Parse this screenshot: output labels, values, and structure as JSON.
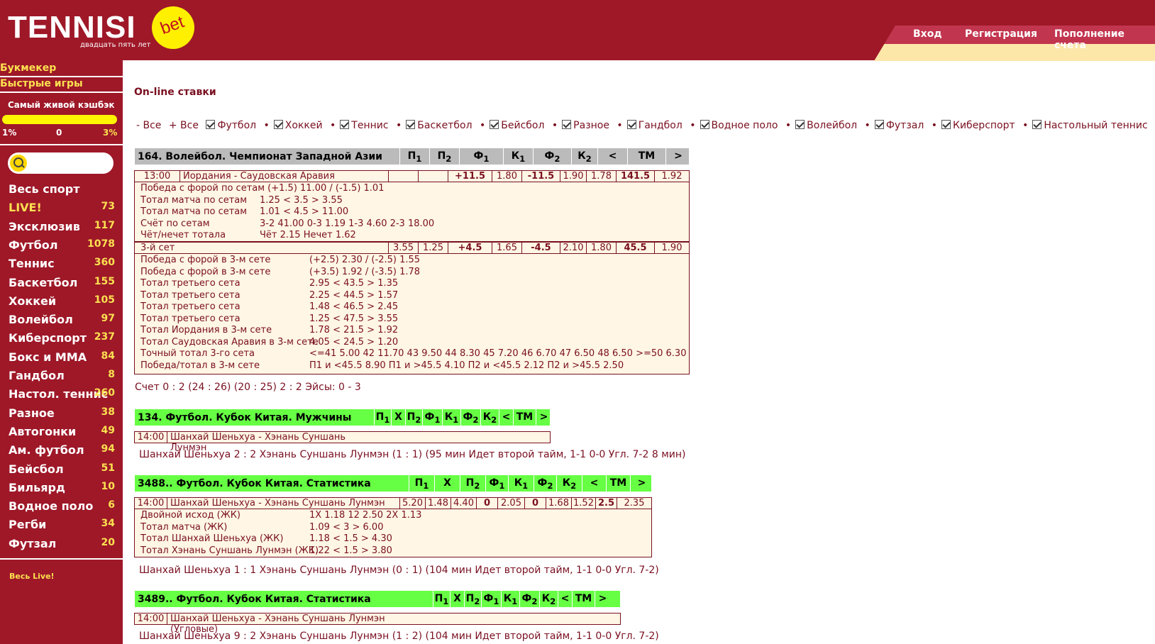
{
  "logo": {
    "name": "TENNISI",
    "bet": "bet",
    "sub": "двадцать пять лет"
  },
  "topnav": [
    "Вход",
    "Регистрация",
    "Пополнение счета"
  ],
  "side": {
    "bookmaker": "Букмекер",
    "fast_games": "Быстрые игры",
    "cashback": "Самый живой кэшбэк",
    "cb_left": "1%",
    "cb_mid": "0",
    "cb_right": "3%",
    "all_live": "Весь Live!",
    "sports": [
      {
        "n": "Весь спорт",
        "c": ""
      },
      {
        "n": "LIVE!",
        "c": "73"
      },
      {
        "n": "Эксклюзив",
        "c": "117"
      },
      {
        "n": "Футбол",
        "c": "1078"
      },
      {
        "n": "Теннис",
        "c": "360"
      },
      {
        "n": "Баскетбол",
        "c": "155"
      },
      {
        "n": "Хоккей",
        "c": "105"
      },
      {
        "n": "Волейбол",
        "c": "97"
      },
      {
        "n": "Киберспорт",
        "c": "237"
      },
      {
        "n": "Бокс и ММА",
        "c": "84"
      },
      {
        "n": "Гандбол",
        "c": "8"
      },
      {
        "n": "Настол. теннис",
        "c": "260"
      },
      {
        "n": "Разное",
        "c": "38"
      },
      {
        "n": "Автогонки",
        "c": "49"
      },
      {
        "n": "Ам. футбол",
        "c": "94"
      },
      {
        "n": "Бейсбол",
        "c": "51"
      },
      {
        "n": "Бильярд",
        "c": "10"
      },
      {
        "n": "Водное поло",
        "c": "6"
      },
      {
        "n": "Регби",
        "c": "34"
      },
      {
        "n": "Футзал",
        "c": "20"
      }
    ]
  },
  "title": "On-line ставки",
  "filters": {
    "minus": "- Все",
    "plus": "+ Все",
    "items": [
      "Футбол",
      "Хоккей",
      "Теннис",
      "Баскетбол",
      "Бейсбол",
      "Разное",
      "Гандбол",
      "Водное поло",
      "Волейбол",
      "Футзал",
      "Киберспорт",
      "Настольный теннис"
    ]
  },
  "h": {
    "p1": "П",
    "x": "X",
    "p2": "П",
    "f1": "Ф",
    "k1": "К",
    "f2": "Ф",
    "k2": "К",
    "lt": "<",
    "tm": "ТМ",
    "gt": ">",
    "s1": "1",
    "s2": "2"
  },
  "e1": {
    "league": "164. Волейбол. Чемпионат Западной Азии",
    "time": "13:00",
    "match": "Иордания - Саудовская Аравия",
    "f1": "+11.5",
    "k1": "1.80",
    "f2": "-11.5",
    "k2": "1.90",
    "lt": "1.78",
    "tm": "141.5",
    "gt": "1.92",
    "lines": [
      "Победа с форой по сетам (+1.5) 11.00 / (-1.5) 1.01",
      "Тотал матча по сетам",
      "Тотал матча по сетам",
      "Счёт по сетам",
      "Чёт/нечет тотала"
    ],
    "vals": [
      "1.25 < 3.5 > 3.55",
      "1.01 < 4.5 > 11.00",
      "3-2 41.00 0-3 1.19 1-3 4.60 2-3 18.00",
      "Чёт 2.15  Нечет 1.62"
    ],
    "set3": {
      "label": "3-й сет",
      "p1": "3.55",
      "p2": "1.25",
      "f1": "+4.5",
      "k1": "1.65",
      "f2": "-4.5",
      "k2": "2.10",
      "lt": "1.80",
      "tm": "45.5",
      "gt": "1.90"
    },
    "l3": [
      "Победа с форой в 3-м сете",
      "Победа с форой в 3-м сете",
      "Тотал третьего сета",
      "Тотал третьего сета",
      "Тотал третьего сета",
      "Тотал третьего сета",
      "Тотал Иордания в 3-м сете",
      "Тотал Саудовская Аравия в 3-м сете",
      "Точный тотал 3-го сета",
      "Победа/тотал в 3-м сете"
    ],
    "v3": [
      "(+2.5) 2.30 / (-2.5) 1.55",
      "(+3.5) 1.92 / (-3.5) 1.78",
      "2.95 < 43.5 > 1.35",
      "2.25 < 44.5 > 1.57",
      "1.48 < 46.5 > 2.45",
      "1.25 < 47.5 > 3.55",
      "1.78 < 21.5 > 1.92",
      "4.05 < 24.5 > 1.20",
      "<=41 5.00 42 11.70 43 9.50 44 8.30 45 7.20 46 6.70 47 6.50 48 6.50 >=50 6.30",
      "П1 и <45.5 8.90  П1 и >45.5 4.10  П2 и <45.5 2.12  П2 и >45.5 2.50"
    ],
    "score": "Счет  0 : 2   (24 : 26)  (20 : 25)  2 : 2   Эйсы: 0 - 3"
  },
  "e2": {
    "league": "134. Футбол. Кубок Китая. Мужчины",
    "time": "14:00",
    "match": "Шанхай Шеньхуа - Хэнань Суншань Лунмэн",
    "status": "Шанхай Шеньхуа  2 : 2  Хэнань Суншань Лунмэн    (1 : 1)   (95 мин Идет второй тайм,   1-1   0-0 Угл. 7-2 8 мин)"
  },
  "e3": {
    "league": "3488.. Футбол. Кубок Китая. Статистика",
    "time": "14:00",
    "match": "Шанхай Шеньхуа - Хэнань Суншань Лунмэн (ЖК)",
    "p1": "5.20",
    "x": "1.48",
    "p2": "4.40",
    "f1": "0",
    "k1": "2.05",
    "f2": "0",
    "k2": "1.68",
    "lt": "1.52",
    "tm": "2.5",
    "gt": "2.35",
    "lines": [
      "Двойной исход (ЖК)",
      "Тотал матча (ЖК)",
      "Тотал Шанхай Шеньхуа (ЖК)",
      "Тотал Хэнань Суншань Лунмэн (ЖК)"
    ],
    "vals": [
      "1X 1.18   12 2.50   2X 1.13",
      "1.09 < 3 > 6.00",
      "1.18 < 1.5 > 4.30",
      "1.22 < 1.5 > 3.80"
    ],
    "status": "Шанхай Шеньхуа  1 : 1  Хэнань Суншань Лунмэн    (0 : 1)   (104 мин Идет второй тайм,   1-1   0-0 Угл. 7-2)"
  },
  "e4": {
    "league": "3489.. Футбол. Кубок Китая. Статистика",
    "time": "14:00",
    "match": "Шанхай Шеньхуа - Хэнань Суншань Лунмэн (Угловые)",
    "status": "Шанхай Шеньхуа  9 : 2  Хэнань Суншань Лунмэн    (1 : 2)   (104 мин Идет второй тайм,   1-1   0-0 Угл. 7-2)"
  },
  "colors": {
    "brand": "#9e1828",
    "yellow": "#fce050",
    "green": "#66ff44"
  }
}
